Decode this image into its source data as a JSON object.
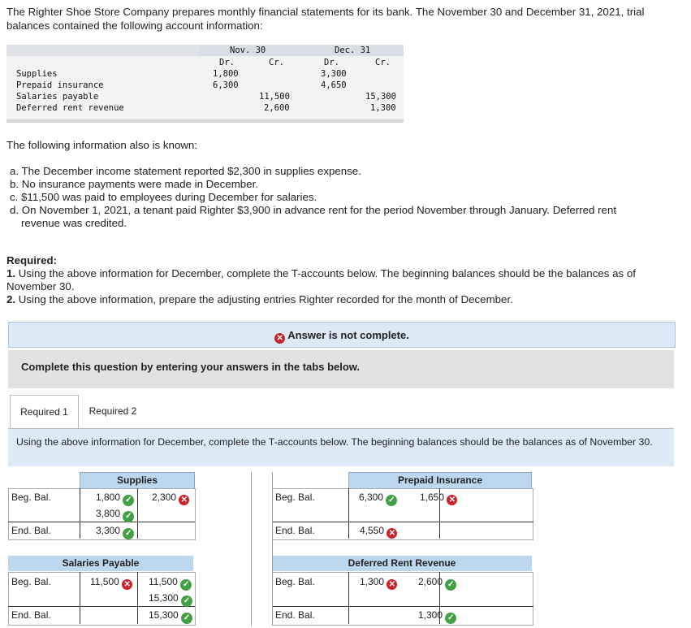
{
  "intro": "The Righter Shoe Store Company prepares monthly financial statements for its bank. The November 30 and December 31, 2021, trial balances contained the following account information:",
  "trial_balance": {
    "nov_header": "Nov. 30",
    "dec_header": "Dec. 31",
    "dr": "Dr.",
    "cr": "Cr.",
    "rows": [
      {
        "account": "Supplies",
        "nov_dr": "1,800",
        "nov_cr": "",
        "dec_dr": "3,300",
        "dec_cr": ""
      },
      {
        "account": "Prepaid insurance",
        "nov_dr": "6,300",
        "nov_cr": "",
        "dec_dr": "4,650",
        "dec_cr": ""
      },
      {
        "account": "Salaries payable",
        "nov_dr": "",
        "nov_cr": "11,500",
        "dec_dr": "",
        "dec_cr": "15,300"
      },
      {
        "account": "Deferred rent revenue",
        "nov_dr": "",
        "nov_cr": "2,600",
        "dec_dr": "",
        "dec_cr": "1,300"
      }
    ]
  },
  "known_intro": "The following information also is known:",
  "known": {
    "a": "a. The December income statement reported $2,300 in supplies expense.",
    "b": "b. No insurance payments were made in December.",
    "c": "c. $11,500 was paid to employees during December for salaries.",
    "d1": "d. On November 1, 2021, a tenant paid Righter $3,900 in advance rent for the period November through January. Deferred rent",
    "d2": "revenue was credited."
  },
  "required": {
    "title": "Required:",
    "r1_num": "1.",
    "r1": " Using the above information for December, complete the T-accounts below. The beginning balances should be the balances as of November 30.",
    "r2_num": "2.",
    "r2": " Using the above information, prepare the adjusting entries Righter recorded for the month of December."
  },
  "banner": {
    "icon": "x-circle-icon",
    "text": "Answer is not complete."
  },
  "complete_msg": "Complete this question by entering your answers in the tabs below.",
  "tabs": {
    "t1": "Required 1",
    "t2": "Required 2"
  },
  "instruction": "Using the above information for December, complete the T-accounts below. The beginning balances should be the balances as of November 30.",
  "labels": {
    "beg": "Beg. Bal.",
    "end": "End. Bal."
  },
  "taccounts": {
    "supplies": {
      "title": "Supplies",
      "d1": "1,800",
      "d2": "3,800",
      "end": "3,300",
      "c1": "2,300"
    },
    "prepaid": {
      "title": "Prepaid Insurance",
      "d1": "6,300",
      "c1": "1,650",
      "end": "4,550"
    },
    "salaries": {
      "title": "Salaries Payable",
      "d1": "11,500",
      "c1": "11,500",
      "c2": "15,300",
      "end": "15,300"
    },
    "deferred": {
      "title": "Deferred Rent Revenue",
      "d1": "1,300",
      "c1": "2,600",
      "end": "1,300"
    }
  },
  "status": {
    "correct": "check-icon",
    "wrong": "x-icon"
  },
  "colors": {
    "banner_bg": "#dbeaf6",
    "header_bg": "#bdd7ee",
    "correct": "#44a047",
    "wrong": "#c9242b"
  }
}
